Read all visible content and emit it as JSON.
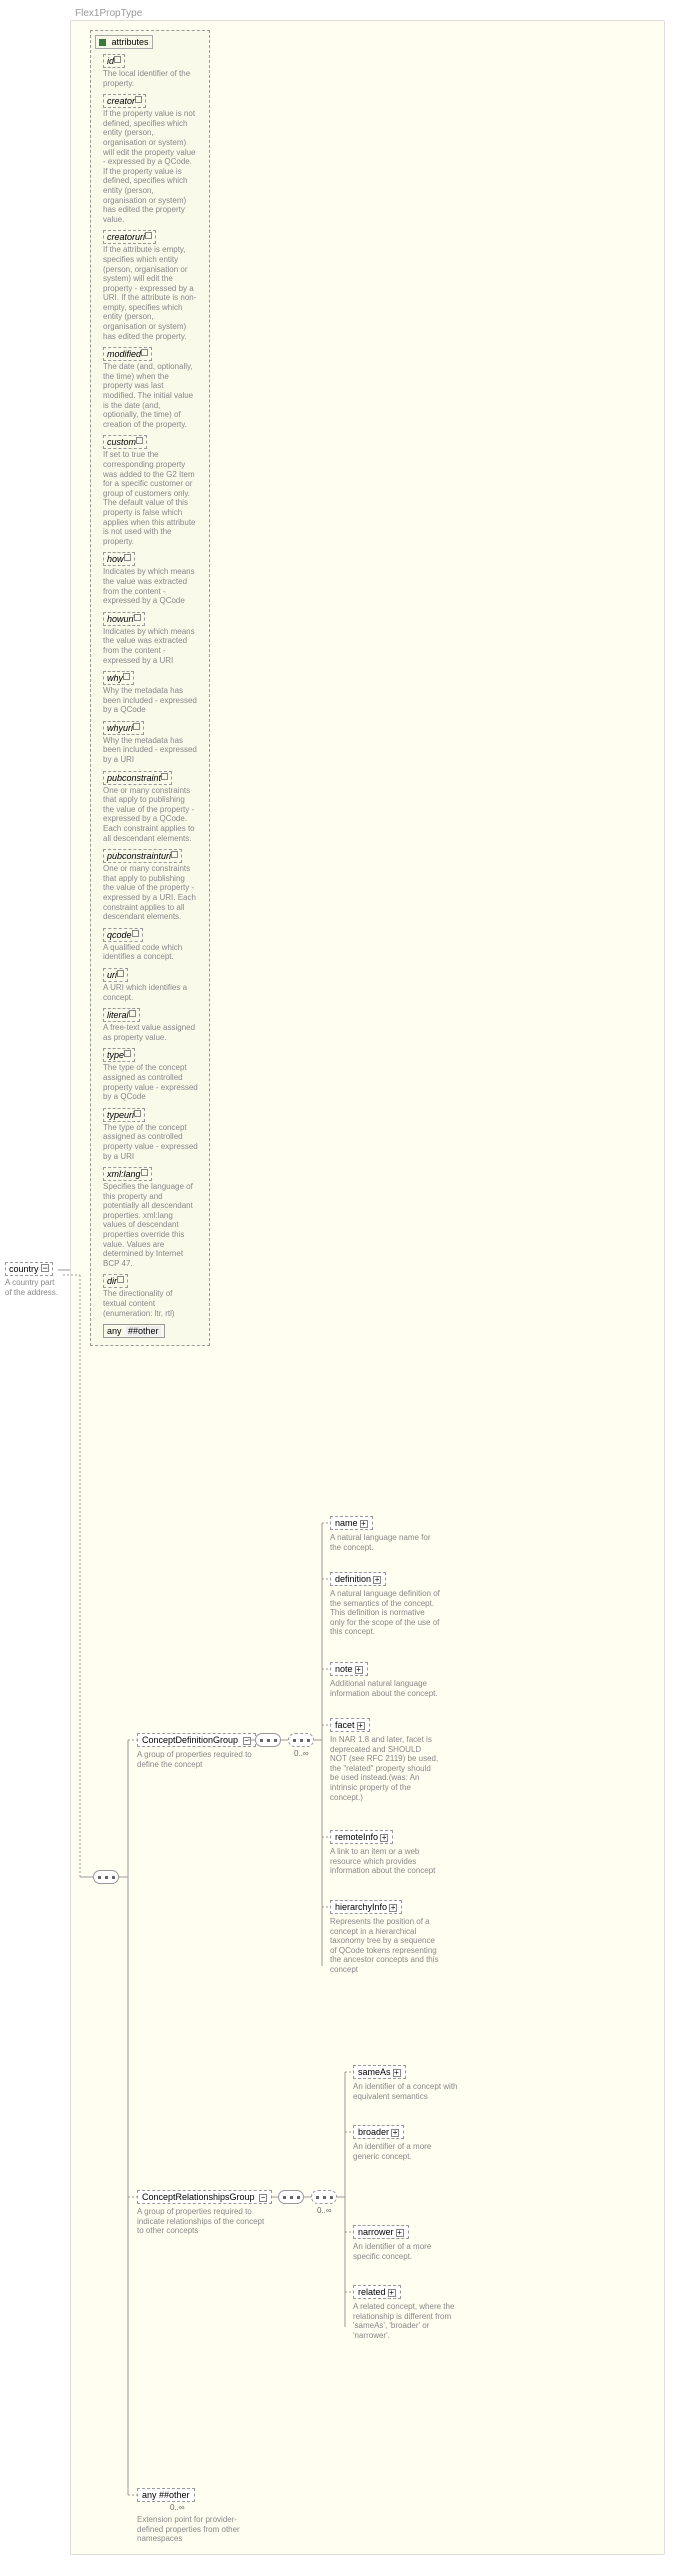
{
  "type_header": "Flex1PropType",
  "attributes_label": "attributes",
  "attributes": [
    {
      "name": "id",
      "desc": "The local identifier of the property."
    },
    {
      "name": "creator",
      "desc": "If the property value is not defined, specifies which entity (person, organisation or system) will edit the property value - expressed by a QCode. If the property value is defined, specifies which entity (person, organisation or system) has edited the property value."
    },
    {
      "name": "creatoruri",
      "desc": "If the attribute is empty, specifies which entity (person, organisation or system) will edit the property - expressed by a URI. If the attribute is non-empty, specifies which entity (person, organisation or system) has edited the property."
    },
    {
      "name": "modified",
      "desc": "The date (and, optionally, the time) when the property was last modified. The initial value is the date (and, optionally, the time) of creation of the property."
    },
    {
      "name": "custom",
      "desc": "If set to true the corresponding property was added to the G2 Item for a specific customer or group of customers only. The default value of this property is false which applies when this attribute is not used with the property."
    },
    {
      "name": "how",
      "desc": "Indicates by which means the value was extracted from the content - expressed by a QCode"
    },
    {
      "name": "howuri",
      "desc": "Indicates by which means the value was extracted from the content - expressed by a URI"
    },
    {
      "name": "why",
      "desc": "Why the metadata has been included - expressed by a QCode"
    },
    {
      "name": "whyuri",
      "desc": "Why the metadata has been included - expressed by a URI"
    },
    {
      "name": "pubconstraint",
      "desc": "One or many constraints that apply to publishing the value of the property - expressed by a QCode. Each constraint applies to all descendant elements."
    },
    {
      "name": "pubconstrainturi",
      "desc": "One or many constraints that apply to publishing the value of the property - expressed by a URI. Each constraint applies to all descendant elements."
    },
    {
      "name": "qcode",
      "desc": "A qualified code which identifies a concept."
    },
    {
      "name": "uri",
      "desc": "A URI which identifies a concept."
    },
    {
      "name": "literal",
      "desc": "A free-text value assigned as property value."
    },
    {
      "name": "type",
      "desc": "The type of the concept assigned as controlled property value - expressed by a QCode"
    },
    {
      "name": "typeuri",
      "desc": "The type of the concept assigned as controlled property value - expressed by a URI"
    },
    {
      "name": "xml:lang",
      "desc": "Specifies the language of this property and potentially all descendant properties. xml:lang values of descendant properties override this value. Values are determined by Internet BCP 47."
    },
    {
      "name": "dir",
      "desc": "The directionality of textual content (enumeration: ltr, rtl)"
    }
  ],
  "any_other": "##other",
  "any_label": "any",
  "country": {
    "label": "country",
    "desc": "A country part of the address."
  },
  "groups": {
    "conceptDef": {
      "label": "ConceptDefinitionGroup",
      "desc": "A group of properties required to define the concept"
    },
    "conceptRel": {
      "label": "ConceptRelationshipsGroup",
      "desc": "A group of properties required to indicate relationships of the concept to other concepts"
    }
  },
  "def_children": [
    {
      "name": "name",
      "desc": "A natural language name for the concept."
    },
    {
      "name": "definition",
      "desc": "A natural language definition of the semantics of the concept. This definition is normative only for the scope of the use of this concept."
    },
    {
      "name": "note",
      "desc": "Additional natural language information about the concept."
    },
    {
      "name": "facet",
      "desc": "In NAR 1.8 and later, facet is deprecated and SHOULD NOT (see RFC 2119) be used, the \"related\" property should be used instead.(was: An intrinsic property of the concept.)"
    },
    {
      "name": "remoteInfo",
      "desc": "A link to an item or a web resource which provides information about the concept"
    },
    {
      "name": "hierarchyInfo",
      "desc": "Represents the position of a concept in a hierarchical taxonomy tree by a sequence of QCode tokens representing the ancestor concepts and this concept"
    }
  ],
  "rel_children": [
    {
      "name": "sameAs",
      "desc": "An identifier of a concept with equivalent semantics"
    },
    {
      "name": "broader",
      "desc": "An identifier of a more generic concept."
    },
    {
      "name": "narrower",
      "desc": "An identifier of a more specific concept."
    },
    {
      "name": "related",
      "desc": "A related concept, where the relationship is different from 'sameAs', 'broader' or 'narrower'."
    }
  ],
  "any_ext": {
    "label": "any ##other",
    "desc": "Extension point for provider-defined properties from other namespaces"
  },
  "card_unbounded": "0..∞"
}
